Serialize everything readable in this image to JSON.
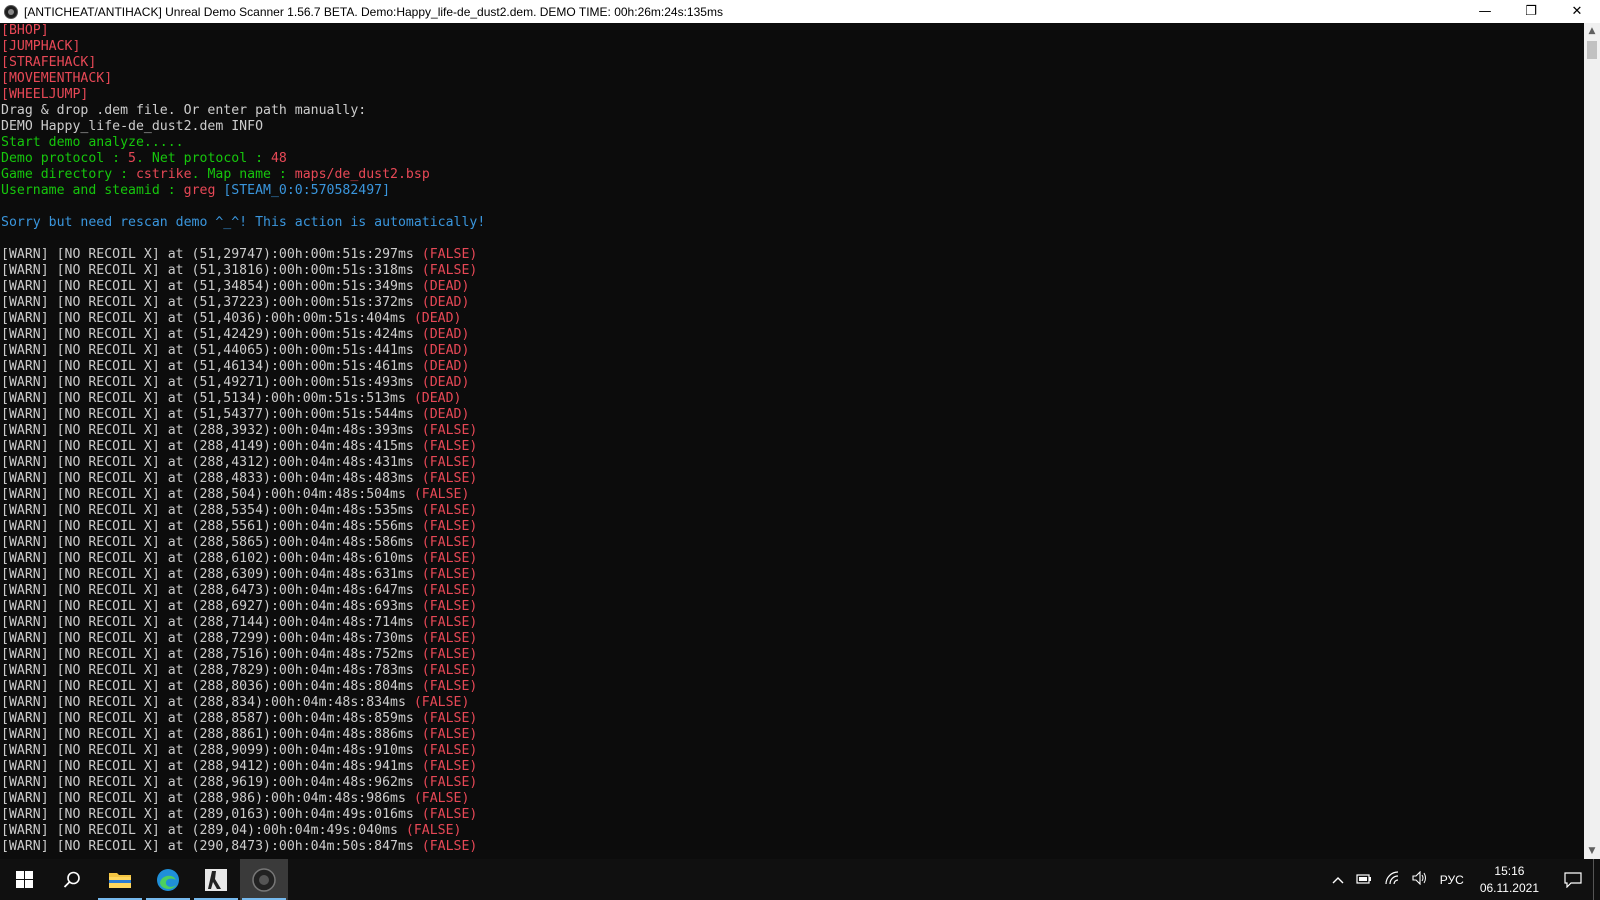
{
  "window": {
    "title": "[ANTICHEAT/ANTIHACK] Unreal Demo Scanner 1.56.7 BETA. Demo:Happy_life-de_dust2.dem. DEMO TIME: 00h:26m:24s:135ms",
    "minimize_glyph": "—",
    "restore_glyph": "❐",
    "close_glyph": "✕"
  },
  "colors": {
    "red": "#e74856",
    "gray": "#cccccc",
    "green": "#16c60c",
    "cyan": "#3a96dd",
    "dark_red": "#c50f1f"
  },
  "console_lines": [
    [
      {
        "t": "[BHOP]",
        "c": "red"
      }
    ],
    [
      {
        "t": "[JUMPHACK]",
        "c": "red"
      }
    ],
    [
      {
        "t": "[STRAFEHACK]",
        "c": "red"
      }
    ],
    [
      {
        "t": "[MOVEMENTHACK]",
        "c": "red"
      }
    ],
    [
      {
        "t": "[WHEELJUMP]",
        "c": "red"
      }
    ],
    [
      {
        "t": "Drag & drop .dem file. Or enter path manually:",
        "c": "gray"
      }
    ],
    [
      {
        "t": "DEMO Happy_life-de_dust2.dem INFO",
        "c": "gray"
      }
    ],
    [
      {
        "t": "Start demo analyze.....",
        "c": "green"
      }
    ],
    [
      {
        "t": "Demo protocol : ",
        "c": "green"
      },
      {
        "t": "5",
        "c": "red"
      },
      {
        "t": ". Net protocol : ",
        "c": "green"
      },
      {
        "t": "48",
        "c": "red"
      }
    ],
    [
      {
        "t": "Game directory : ",
        "c": "green"
      },
      {
        "t": "cstrike",
        "c": "red"
      },
      {
        "t": ". Map name : ",
        "c": "green"
      },
      {
        "t": "maps/de_dust2.bsp",
        "c": "red"
      }
    ],
    [
      {
        "t": "Username and steamid : ",
        "c": "green"
      },
      {
        "t": "greg",
        "c": "red"
      },
      {
        "t": " [STEAM_0:0:570582497]",
        "c": "cyan"
      }
    ],
    [
      {
        "t": "",
        "c": "gray"
      }
    ],
    [
      {
        "t": "Sorry but need rescan demo ^_^! This action is automatically!",
        "c": "cyan"
      }
    ],
    [
      {
        "t": "",
        "c": "gray"
      }
    ],
    [
      {
        "t": "[WARN] [NO RECOIL X] at (51,29747):00h:00m:51s:297ms ",
        "c": "gray"
      },
      {
        "t": "(FALSE)",
        "c": "red"
      }
    ],
    [
      {
        "t": "[WARN] [NO RECOIL X] at (51,31816):00h:00m:51s:318ms ",
        "c": "gray"
      },
      {
        "t": "(FALSE)",
        "c": "red"
      }
    ],
    [
      {
        "t": "[WARN] [NO RECOIL X] at (51,34854):00h:00m:51s:349ms ",
        "c": "gray"
      },
      {
        "t": "(DEAD)",
        "c": "red"
      }
    ],
    [
      {
        "t": "[WARN] [NO RECOIL X] at (51,37223):00h:00m:51s:372ms ",
        "c": "gray"
      },
      {
        "t": "(DEAD)",
        "c": "red"
      }
    ],
    [
      {
        "t": "[WARN] [NO RECOIL X] at (51,4036):00h:00m:51s:404ms ",
        "c": "gray"
      },
      {
        "t": "(DEAD)",
        "c": "red"
      }
    ],
    [
      {
        "t": "[WARN] [NO RECOIL X] at (51,42429):00h:00m:51s:424ms ",
        "c": "gray"
      },
      {
        "t": "(DEAD)",
        "c": "red"
      }
    ],
    [
      {
        "t": "[WARN] [NO RECOIL X] at (51,44065):00h:00m:51s:441ms ",
        "c": "gray"
      },
      {
        "t": "(DEAD)",
        "c": "red"
      }
    ],
    [
      {
        "t": "[WARN] [NO RECOIL X] at (51,46134):00h:00m:51s:461ms ",
        "c": "gray"
      },
      {
        "t": "(DEAD)",
        "c": "red"
      }
    ],
    [
      {
        "t": "[WARN] [NO RECOIL X] at (51,49271):00h:00m:51s:493ms ",
        "c": "gray"
      },
      {
        "t": "(DEAD)",
        "c": "red"
      }
    ],
    [
      {
        "t": "[WARN] [NO RECOIL X] at (51,5134):00h:00m:51s:513ms ",
        "c": "gray"
      },
      {
        "t": "(DEAD)",
        "c": "red"
      }
    ],
    [
      {
        "t": "[WARN] [NO RECOIL X] at (51,54377):00h:00m:51s:544ms ",
        "c": "gray"
      },
      {
        "t": "(DEAD)",
        "c": "red"
      }
    ],
    [
      {
        "t": "[WARN] [NO RECOIL X] at (288,3932):00h:04m:48s:393ms ",
        "c": "gray"
      },
      {
        "t": "(FALSE)",
        "c": "red"
      }
    ],
    [
      {
        "t": "[WARN] [NO RECOIL X] at (288,4149):00h:04m:48s:415ms ",
        "c": "gray"
      },
      {
        "t": "(FALSE)",
        "c": "red"
      }
    ],
    [
      {
        "t": "[WARN] [NO RECOIL X] at (288,4312):00h:04m:48s:431ms ",
        "c": "gray"
      },
      {
        "t": "(FALSE)",
        "c": "red"
      }
    ],
    [
      {
        "t": "[WARN] [NO RECOIL X] at (288,4833):00h:04m:48s:483ms ",
        "c": "gray"
      },
      {
        "t": "(FALSE)",
        "c": "red"
      }
    ],
    [
      {
        "t": "[WARN] [NO RECOIL X] at (288,504):00h:04m:48s:504ms ",
        "c": "gray"
      },
      {
        "t": "(FALSE)",
        "c": "red"
      }
    ],
    [
      {
        "t": "[WARN] [NO RECOIL X] at (288,5354):00h:04m:48s:535ms ",
        "c": "gray"
      },
      {
        "t": "(FALSE)",
        "c": "red"
      }
    ],
    [
      {
        "t": "[WARN] [NO RECOIL X] at (288,5561):00h:04m:48s:556ms ",
        "c": "gray"
      },
      {
        "t": "(FALSE)",
        "c": "red"
      }
    ],
    [
      {
        "t": "[WARN] [NO RECOIL X] at (288,5865):00h:04m:48s:586ms ",
        "c": "gray"
      },
      {
        "t": "(FALSE)",
        "c": "red"
      }
    ],
    [
      {
        "t": "[WARN] [NO RECOIL X] at (288,6102):00h:04m:48s:610ms ",
        "c": "gray"
      },
      {
        "t": "(FALSE)",
        "c": "red"
      }
    ],
    [
      {
        "t": "[WARN] [NO RECOIL X] at (288,6309):00h:04m:48s:631ms ",
        "c": "gray"
      },
      {
        "t": "(FALSE)",
        "c": "red"
      }
    ],
    [
      {
        "t": "[WARN] [NO RECOIL X] at (288,6473):00h:04m:48s:647ms ",
        "c": "gray"
      },
      {
        "t": "(FALSE)",
        "c": "red"
      }
    ],
    [
      {
        "t": "[WARN] [NO RECOIL X] at (288,6927):00h:04m:48s:693ms ",
        "c": "gray"
      },
      {
        "t": "(FALSE)",
        "c": "red"
      }
    ],
    [
      {
        "t": "[WARN] [NO RECOIL X] at (288,7144):00h:04m:48s:714ms ",
        "c": "gray"
      },
      {
        "t": "(FALSE)",
        "c": "red"
      }
    ],
    [
      {
        "t": "[WARN] [NO RECOIL X] at (288,7299):00h:04m:48s:730ms ",
        "c": "gray"
      },
      {
        "t": "(FALSE)",
        "c": "red"
      }
    ],
    [
      {
        "t": "[WARN] [NO RECOIL X] at (288,7516):00h:04m:48s:752ms ",
        "c": "gray"
      },
      {
        "t": "(FALSE)",
        "c": "red"
      }
    ],
    [
      {
        "t": "[WARN] [NO RECOIL X] at (288,7829):00h:04m:48s:783ms ",
        "c": "gray"
      },
      {
        "t": "(FALSE)",
        "c": "red"
      }
    ],
    [
      {
        "t": "[WARN] [NO RECOIL X] at (288,8036):00h:04m:48s:804ms ",
        "c": "gray"
      },
      {
        "t": "(FALSE)",
        "c": "red"
      }
    ],
    [
      {
        "t": "[WARN] [NO RECOIL X] at (288,834):00h:04m:48s:834ms ",
        "c": "gray"
      },
      {
        "t": "(FALSE)",
        "c": "red"
      }
    ],
    [
      {
        "t": "[WARN] [NO RECOIL X] at (288,8587):00h:04m:48s:859ms ",
        "c": "gray"
      },
      {
        "t": "(FALSE)",
        "c": "red"
      }
    ],
    [
      {
        "t": "[WARN] [NO RECOIL X] at (288,8861):00h:04m:48s:886ms ",
        "c": "gray"
      },
      {
        "t": "(FALSE)",
        "c": "red"
      }
    ],
    [
      {
        "t": "[WARN] [NO RECOIL X] at (288,9099):00h:04m:48s:910ms ",
        "c": "gray"
      },
      {
        "t": "(FALSE)",
        "c": "red"
      }
    ],
    [
      {
        "t": "[WARN] [NO RECOIL X] at (288,9412):00h:04m:48s:941ms ",
        "c": "gray"
      },
      {
        "t": "(FALSE)",
        "c": "red"
      }
    ],
    [
      {
        "t": "[WARN] [NO RECOIL X] at (288,9619):00h:04m:48s:962ms ",
        "c": "gray"
      },
      {
        "t": "(FALSE)",
        "c": "red"
      }
    ],
    [
      {
        "t": "[WARN] [NO RECOIL X] at (288,986):00h:04m:48s:986ms ",
        "c": "gray"
      },
      {
        "t": "(FALSE)",
        "c": "red"
      }
    ],
    [
      {
        "t": "[WARN] [NO RECOIL X] at (289,0163):00h:04m:49s:016ms ",
        "c": "gray"
      },
      {
        "t": "(FALSE)",
        "c": "red"
      }
    ],
    [
      {
        "t": "[WARN] [NO RECOIL X] at (289,04):00h:04m:49s:040ms ",
        "c": "gray"
      },
      {
        "t": "(FALSE)",
        "c": "red"
      }
    ],
    [
      {
        "t": "[WARN] [NO RECOIL X] at (290,8473):00h:04m:50s:847ms ",
        "c": "gray"
      },
      {
        "t": "(FALSE)",
        "c": "red"
      }
    ]
  ],
  "taskbar": {
    "start_icon": "windows-start-icon",
    "search_icon": "search-icon",
    "apps": [
      "file-explorer-icon",
      "edge-browser-icon",
      "counter-strike-icon",
      "demo-scanner-icon"
    ],
    "tray": {
      "language": "РУС",
      "time": "15:16",
      "date": "06.11.2021"
    }
  }
}
